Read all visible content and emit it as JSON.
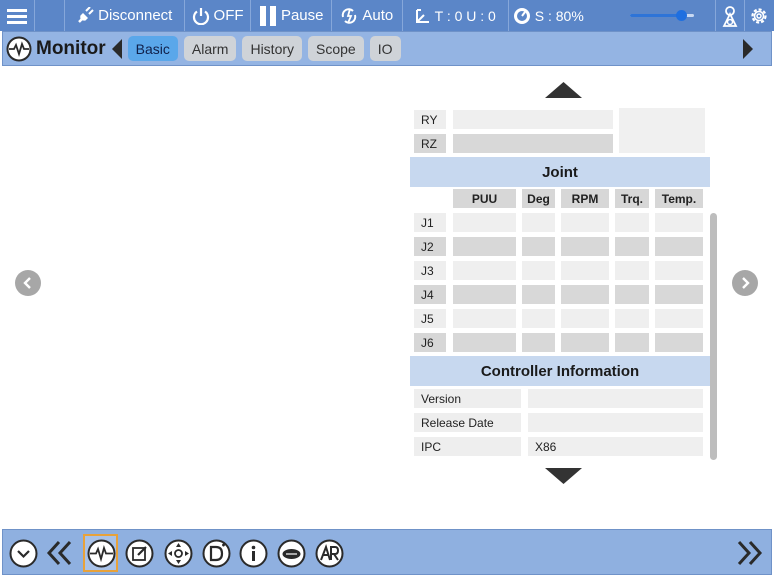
{
  "topbar": {
    "disconnect_label": "Disconnect",
    "servo_label": "OFF",
    "pause_label": "Pause",
    "mode_label": "Auto",
    "tool_label": "T : 0 U : 0",
    "speed_label": "S : 80%",
    "speed_value": 0.8
  },
  "nav": {
    "title": "Monitor",
    "tabs": [
      "Basic",
      "Alarm",
      "History",
      "Scope",
      "IO"
    ],
    "active_tab": "Basic"
  },
  "position_rows": [
    "RY",
    "RZ"
  ],
  "joint": {
    "section_title": "Joint",
    "columns": [
      "PUU",
      "Deg",
      "RPM",
      "Trq.",
      "Temp."
    ],
    "rows": [
      "J1",
      "J2",
      "J3",
      "J4",
      "J5",
      "J6"
    ]
  },
  "controller": {
    "section_title": "Controller Information",
    "rows": [
      {
        "label": "Version",
        "value": ""
      },
      {
        "label": "Release Date",
        "value": ""
      },
      {
        "label": "IPC",
        "value": "X86"
      }
    ]
  },
  "colors": {
    "toolbar": "#5b86c8",
    "navbar": "#94b4e3",
    "active_tab": "#5aa7ea",
    "section_header": "#c7d8ef",
    "highlight": "#e8a23a"
  },
  "icons": {
    "bottom": [
      "chevron-down-circle-icon",
      "double-chevron-left-icon",
      "monitor-wave-icon",
      "edit-icon",
      "jog-icon",
      "d-program-icon",
      "info-icon",
      "robot-3d-icon",
      "ar-icon",
      "double-chevron-right-icon"
    ]
  }
}
